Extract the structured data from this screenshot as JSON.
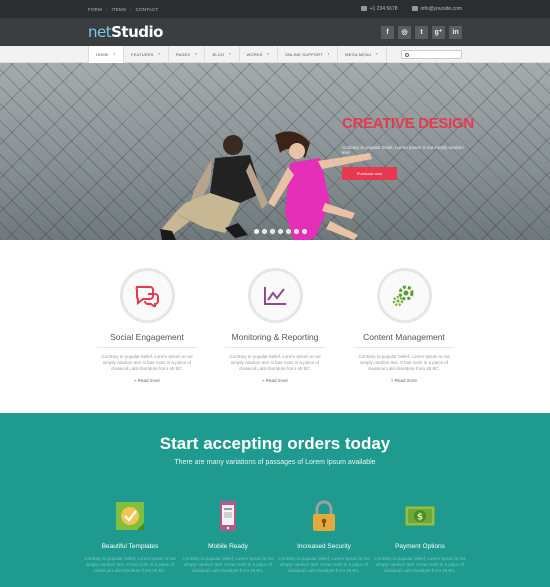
{
  "topbar": {
    "links": [
      "FORM",
      "ITEMS",
      "CONTACT"
    ],
    "phone": "+1 234 5678",
    "email": "info@yoursite.com"
  },
  "header": {
    "logo_part1": "net",
    "logo_part2": "Studio",
    "socials": [
      "f",
      "◎",
      "t",
      "g⁺",
      "in"
    ]
  },
  "nav": {
    "items": [
      "HOME",
      "FEATURES",
      "PAGES",
      "BLOG",
      "WORKS",
      "ONLINE SUPPORT",
      "MEGA MENU"
    ],
    "search_placeholder": ""
  },
  "hero": {
    "title": "CREATIVE DESIGN",
    "subtitle": "Contrary to popular belief, Lorem Ipsum is not simply random text",
    "button": "Purchase now",
    "slides": 7,
    "active_slide": 1
  },
  "features": [
    {
      "title": "Social Engagement",
      "text": "Contrary to popular belief, Lorem Ipsum is not simply random text. It has roots in a piece of classical Latin literature from 45 BC.",
      "more": "» Read more",
      "icon": "chat-bubbles-icon",
      "color": "#e8384f"
    },
    {
      "title": "Monitoring & Reporting",
      "text": "Contrary to popular belief, Lorem Ipsum is not simply random text. It has roots in a piece of classical Latin literature from 45 BC.",
      "more": "» Read more",
      "icon": "chart-icon",
      "color": "#8e4a8f"
    },
    {
      "title": "Content Management",
      "text": "Contrary to popular belief, Lorem Ipsum is not simply random text. It has roots in a piece of classical Latin literature from 45 BC.",
      "more": "» Read more",
      "icon": "gears-icon",
      "color": "#5a9e2f"
    }
  ],
  "cta": {
    "title": "Start accepting orders today",
    "subtitle": "There are many variations of passages of Lorem Ipsum available"
  },
  "teal_features": [
    {
      "title": "Beautiful Templates",
      "text": "Contrary to popular belief, Lorem Ipsum is not simply random text. It has roots in a piece of classical Latin literature from 45 BC.",
      "icon": "template-icon"
    },
    {
      "title": "Mobile Ready",
      "text": "Contrary to popular belief, Lorem Ipsum is not simply random text. It has roots in a piece of classical Latin literature from 45 BC.",
      "icon": "mobile-icon"
    },
    {
      "title": "Increased Security",
      "text": "Contrary to popular belief, Lorem Ipsum is not simply random text. It has roots in a piece of classical Latin literature from 45 BC.",
      "icon": "lock-icon"
    },
    {
      "title": "Payment Options",
      "text": "Contrary to popular belief, Lorem Ipsum is not simply random text. It has roots in a piece of classical Latin literature from 45 BC.",
      "icon": "money-icon"
    }
  ]
}
